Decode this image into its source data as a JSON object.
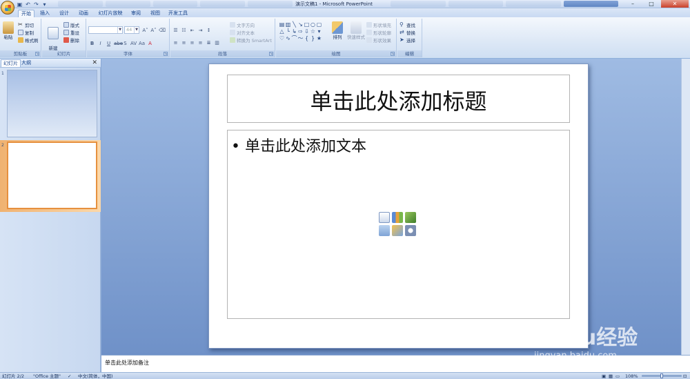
{
  "window": {
    "title": "演示文稿1 - Microsoft PowerPoint"
  },
  "ribbon_tabs": [
    "开始",
    "插入",
    "设计",
    "动画",
    "幻灯片放映",
    "审阅",
    "视图",
    "开发工具"
  ],
  "clipboard": {
    "paste": "粘贴",
    "cut": "剪切",
    "copy": "复制",
    "format_painter": "格式刷",
    "group_label": "剪贴板"
  },
  "slides_group": {
    "new_slide": "新建\n幻灯片",
    "layout": "版式",
    "reset": "重设",
    "delete": "删除",
    "group_label": "幻灯片"
  },
  "font_group": {
    "font_name": "",
    "font_size": "44",
    "group_label": "字体"
  },
  "paragraph_group": {
    "text_direction": "文字方向",
    "align_text": "对齐文本",
    "convert_smartart": "转换为 SmartArt",
    "group_label": "段落"
  },
  "drawing_group": {
    "arrange": "排列",
    "quick_styles": "快速样式",
    "shape_fill": "形状填充",
    "shape_outline": "形状轮廓",
    "shape_effects": "形状效果",
    "group_label": "绘图"
  },
  "editing_group": {
    "find": "查找",
    "replace": "替换",
    "select": "选择",
    "group_label": "编辑"
  },
  "left_panel": {
    "tab_slides": "幻灯片",
    "tab_outline": "大纲",
    "close": "✕",
    "slide_numbers": [
      "1",
      "2"
    ]
  },
  "slide": {
    "title_placeholder": "单击此处添加标题",
    "body_placeholder": "单击此处添加文本",
    "bullet": "•"
  },
  "notes": {
    "placeholder": "单击此处添加备注"
  },
  "status": {
    "slide_count": "幻灯片 2/2",
    "theme": "\"Office 主题\"",
    "language": "中文(简体，中国)",
    "zoom": "108%"
  },
  "watermark": {
    "brand": "Baidu经验",
    "url": "jingyan.baidu.com"
  },
  "colors": {
    "ribbon_text": "#15428b",
    "selected_slide_border": "#e6903e",
    "app_background": "#8aa9d6"
  }
}
